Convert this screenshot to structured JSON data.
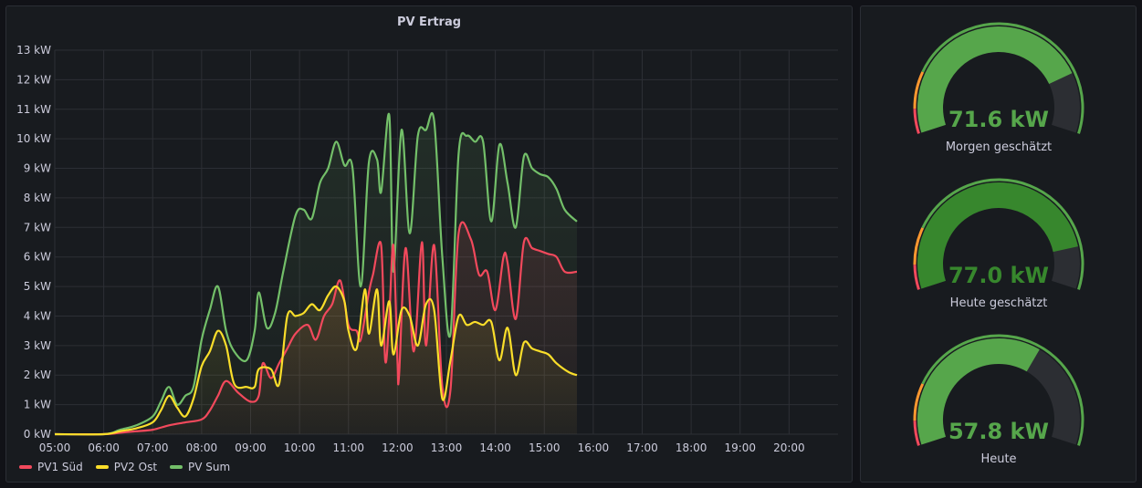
{
  "chart_data": {
    "type": "line",
    "title": "PV Ertrag",
    "xlabel": "",
    "ylabel": "",
    "x_range": [
      "05:00",
      "21:00"
    ],
    "y_range": [
      0,
      13
    ],
    "y_unit": "kW",
    "y_ticks": [
      "0 kW",
      "1 kW",
      "2 kW",
      "3 kW",
      "4 kW",
      "5 kW",
      "6 kW",
      "7 kW",
      "8 kW",
      "9 kW",
      "10 kW",
      "11 kW",
      "12 kW",
      "13 kW"
    ],
    "x_ticks": [
      "05:00",
      "06:00",
      "07:00",
      "08:00",
      "09:00",
      "10:00",
      "11:00",
      "12:00",
      "13:00",
      "14:00",
      "15:00",
      "16:00",
      "17:00",
      "18:00",
      "19:00",
      "20:00"
    ],
    "grid": true,
    "legend_position": "bottom-left",
    "series": [
      {
        "name": "PV1 Süd",
        "color": "#f2495c",
        "points": [
          [
            "05:00",
            0
          ],
          [
            "06:00",
            0
          ],
          [
            "06:20",
            0.05
          ],
          [
            "06:40",
            0.1
          ],
          [
            "07:00",
            0.15
          ],
          [
            "07:20",
            0.3
          ],
          [
            "07:40",
            0.4
          ],
          [
            "08:00",
            0.5
          ],
          [
            "08:10",
            0.8
          ],
          [
            "08:20",
            1.3
          ],
          [
            "08:30",
            1.8
          ],
          [
            "08:45",
            1.4
          ],
          [
            "09:00",
            1.1
          ],
          [
            "09:10",
            1.3
          ],
          [
            "09:15",
            2.4
          ],
          [
            "09:25",
            1.9
          ],
          [
            "09:35",
            2.4
          ],
          [
            "09:45",
            2.9
          ],
          [
            "09:55",
            3.4
          ],
          [
            "10:10",
            3.7
          ],
          [
            "10:20",
            3.2
          ],
          [
            "10:30",
            4.0
          ],
          [
            "10:40",
            4.4
          ],
          [
            "10:50",
            5.2
          ],
          [
            "11:00",
            3.7
          ],
          [
            "11:10",
            3.5
          ],
          [
            "11:15",
            3.2
          ],
          [
            "11:25",
            4.8
          ],
          [
            "11:30",
            5.4
          ],
          [
            "11:40",
            6.4
          ],
          [
            "11:45",
            2.5
          ],
          [
            "11:50",
            4.0
          ],
          [
            "11:55",
            6.4
          ],
          [
            "12:00",
            2.5
          ],
          [
            "12:02",
            2.0
          ],
          [
            "12:10",
            6.3
          ],
          [
            "12:20",
            2.8
          ],
          [
            "12:30",
            6.5
          ],
          [
            "12:35",
            3.0
          ],
          [
            "12:45",
            6.4
          ],
          [
            "12:55",
            1.6
          ],
          [
            "13:05",
            1.5
          ],
          [
            "13:15",
            6.8
          ],
          [
            "13:30",
            6.6
          ],
          [
            "13:40",
            5.4
          ],
          [
            "13:50",
            5.5
          ],
          [
            "14:00",
            4.2
          ],
          [
            "14:10",
            6.0
          ],
          [
            "14:15",
            5.8
          ],
          [
            "14:25",
            3.9
          ],
          [
            "14:35",
            6.5
          ],
          [
            "14:45",
            6.3
          ],
          [
            "14:55",
            6.2
          ],
          [
            "15:05",
            6.1
          ],
          [
            "15:15",
            6.0
          ],
          [
            "15:25",
            5.5
          ],
          [
            "15:40",
            5.5
          ]
        ]
      },
      {
        "name": "PV2 Ost",
        "color": "#fade2a",
        "points": [
          [
            "05:00",
            0
          ],
          [
            "06:00",
            0
          ],
          [
            "06:20",
            0.1
          ],
          [
            "06:40",
            0.2
          ],
          [
            "07:00",
            0.4
          ],
          [
            "07:10",
            0.8
          ],
          [
            "07:20",
            1.3
          ],
          [
            "07:30",
            0.9
          ],
          [
            "07:40",
            0.6
          ],
          [
            "07:50",
            1.2
          ],
          [
            "08:00",
            2.3
          ],
          [
            "08:10",
            2.8
          ],
          [
            "08:20",
            3.5
          ],
          [
            "08:30",
            3.0
          ],
          [
            "08:40",
            1.7
          ],
          [
            "08:55",
            1.6
          ],
          [
            "09:05",
            1.6
          ],
          [
            "09:10",
            2.2
          ],
          [
            "09:25",
            2.2
          ],
          [
            "09:35",
            1.7
          ],
          [
            "09:45",
            4.0
          ],
          [
            "09:55",
            4.0
          ],
          [
            "10:05",
            4.1
          ],
          [
            "10:15",
            4.4
          ],
          [
            "10:25",
            4.2
          ],
          [
            "10:35",
            4.7
          ],
          [
            "10:45",
            5.0
          ],
          [
            "10:55",
            4.5
          ],
          [
            "11:00",
            3.5
          ],
          [
            "11:10",
            2.9
          ],
          [
            "11:20",
            4.9
          ],
          [
            "11:25",
            3.4
          ],
          [
            "11:35",
            4.9
          ],
          [
            "11:40",
            3.0
          ],
          [
            "11:50",
            4.5
          ],
          [
            "11:55",
            2.7
          ],
          [
            "12:05",
            4.2
          ],
          [
            "12:15",
            4.0
          ],
          [
            "12:25",
            3.0
          ],
          [
            "12:35",
            4.4
          ],
          [
            "12:45",
            4.2
          ],
          [
            "12:55",
            1.2
          ],
          [
            "13:05",
            2.5
          ],
          [
            "13:15",
            4.0
          ],
          [
            "13:25",
            3.7
          ],
          [
            "13:35",
            3.8
          ],
          [
            "13:45",
            3.7
          ],
          [
            "13:55",
            3.8
          ],
          [
            "14:05",
            2.5
          ],
          [
            "14:15",
            3.6
          ],
          [
            "14:25",
            2.0
          ],
          [
            "14:35",
            3.1
          ],
          [
            "14:45",
            2.9
          ],
          [
            "14:55",
            2.8
          ],
          [
            "15:05",
            2.7
          ],
          [
            "15:15",
            2.4
          ],
          [
            "15:30",
            2.1
          ],
          [
            "15:40",
            2.0
          ]
        ]
      },
      {
        "name": "PV Sum",
        "color": "#73bf69",
        "points": [
          [
            "05:00",
            0
          ],
          [
            "06:00",
            0
          ],
          [
            "06:20",
            0.15
          ],
          [
            "06:40",
            0.3
          ],
          [
            "07:00",
            0.6
          ],
          [
            "07:10",
            1.1
          ],
          [
            "07:20",
            1.6
          ],
          [
            "07:30",
            1.0
          ],
          [
            "07:40",
            1.3
          ],
          [
            "07:50",
            1.6
          ],
          [
            "08:00",
            3.2
          ],
          [
            "08:10",
            4.2
          ],
          [
            "08:20",
            5.0
          ],
          [
            "08:30",
            3.5
          ],
          [
            "08:40",
            2.8
          ],
          [
            "08:55",
            2.5
          ],
          [
            "09:05",
            3.5
          ],
          [
            "09:10",
            4.8
          ],
          [
            "09:20",
            3.6
          ],
          [
            "09:30",
            4.1
          ],
          [
            "09:40",
            5.5
          ],
          [
            "09:55",
            7.4
          ],
          [
            "10:05",
            7.6
          ],
          [
            "10:15",
            7.3
          ],
          [
            "10:25",
            8.5
          ],
          [
            "10:35",
            9.0
          ],
          [
            "10:45",
            9.9
          ],
          [
            "10:55",
            9.1
          ],
          [
            "11:05",
            9.0
          ],
          [
            "11:15",
            5.0
          ],
          [
            "11:25",
            9.2
          ],
          [
            "11:35",
            9.3
          ],
          [
            "11:40",
            8.2
          ],
          [
            "11:50",
            10.8
          ],
          [
            "11:55",
            5.5
          ],
          [
            "12:05",
            10.3
          ],
          [
            "12:15",
            6.8
          ],
          [
            "12:25",
            10.1
          ],
          [
            "12:35",
            10.3
          ],
          [
            "12:45",
            10.6
          ],
          [
            "12:55",
            6.0
          ],
          [
            "13:05",
            3.4
          ],
          [
            "13:15",
            9.5
          ],
          [
            "13:25",
            10.1
          ],
          [
            "13:35",
            9.9
          ],
          [
            "13:45",
            9.9
          ],
          [
            "13:55",
            7.2
          ],
          [
            "14:05",
            9.8
          ],
          [
            "14:15",
            8.5
          ],
          [
            "14:25",
            7.0
          ],
          [
            "14:35",
            9.4
          ],
          [
            "14:45",
            9.0
          ],
          [
            "14:55",
            8.8
          ],
          [
            "15:05",
            8.7
          ],
          [
            "15:15",
            8.3
          ],
          [
            "15:25",
            7.6
          ],
          [
            "15:40",
            7.2
          ]
        ]
      }
    ]
  },
  "gauges": [
    {
      "value": 71.6,
      "value_text": "71.6 kW",
      "label": "Morgen geschätzt",
      "fill_fraction": 0.8,
      "fill_color": "#56a64b",
      "value_color": "#56a64b"
    },
    {
      "value": 77.0,
      "value_text": "77.0 kW",
      "label": "Heute geschätzt",
      "fill_fraction": 0.86,
      "fill_color": "#37872d",
      "value_color": "#37872d"
    },
    {
      "value": 57.8,
      "value_text": "57.8 kW",
      "label": "Heute",
      "fill_fraction": 0.64,
      "fill_color": "#56a64b",
      "value_color": "#56a64b"
    }
  ],
  "threshold_colors": {
    "red": "#f2495c",
    "orange": "#ff9830",
    "green": "#56a64b",
    "track": "#2c2e33"
  }
}
